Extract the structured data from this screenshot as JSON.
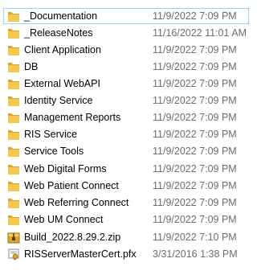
{
  "colors": {
    "folder": "#f4c84c",
    "folder_dark": "#dca52a",
    "selection_border": "#99d1ff",
    "date_text": "#6d6d6d"
  },
  "files": [
    {
      "name": "_Documentation",
      "modified": "11/9/2022 7:09 PM",
      "icon": "folder-icon"
    },
    {
      "name": "_ReleaseNotes",
      "modified": "11/16/2022 11:01 AM",
      "icon": "folder-icon"
    },
    {
      "name": "Client Application",
      "modified": "11/9/2022 7:09 PM",
      "icon": "folder-icon"
    },
    {
      "name": "DB",
      "modified": "11/9/2022 7:09 PM",
      "icon": "folder-icon"
    },
    {
      "name": "External WebAPI",
      "modified": "11/9/2022 7:09 PM",
      "icon": "folder-icon"
    },
    {
      "name": "Identity Service",
      "modified": "11/9/2022 7:09 PM",
      "icon": "folder-icon"
    },
    {
      "name": "Management Reports",
      "modified": "11/9/2022 7:09 PM",
      "icon": "folder-icon"
    },
    {
      "name": "RIS Service",
      "modified": "11/9/2022 7:09 PM",
      "icon": "folder-icon"
    },
    {
      "name": "Service Tools",
      "modified": "11/9/2022 7:09 PM",
      "icon": "folder-icon"
    },
    {
      "name": "Web Digital Forms",
      "modified": "11/9/2022 7:09 PM",
      "icon": "folder-icon"
    },
    {
      "name": "Web Patient Connect",
      "modified": "11/9/2022 7:09 PM",
      "icon": "folder-icon"
    },
    {
      "name": "Web Referring Connect",
      "modified": "11/9/2022 7:09 PM",
      "icon": "folder-icon"
    },
    {
      "name": "Web UM Connect",
      "modified": "11/9/2022 7:09 PM",
      "icon": "folder-icon"
    },
    {
      "name": "Build_2022.8.29.2.zip",
      "modified": "11/9/2022 7:10 PM",
      "icon": "zip-archive-icon"
    },
    {
      "name": "RISServerMasterCert.pfx",
      "modified": "3/31/2016 1:38 PM",
      "icon": "certificate-file-icon"
    }
  ]
}
